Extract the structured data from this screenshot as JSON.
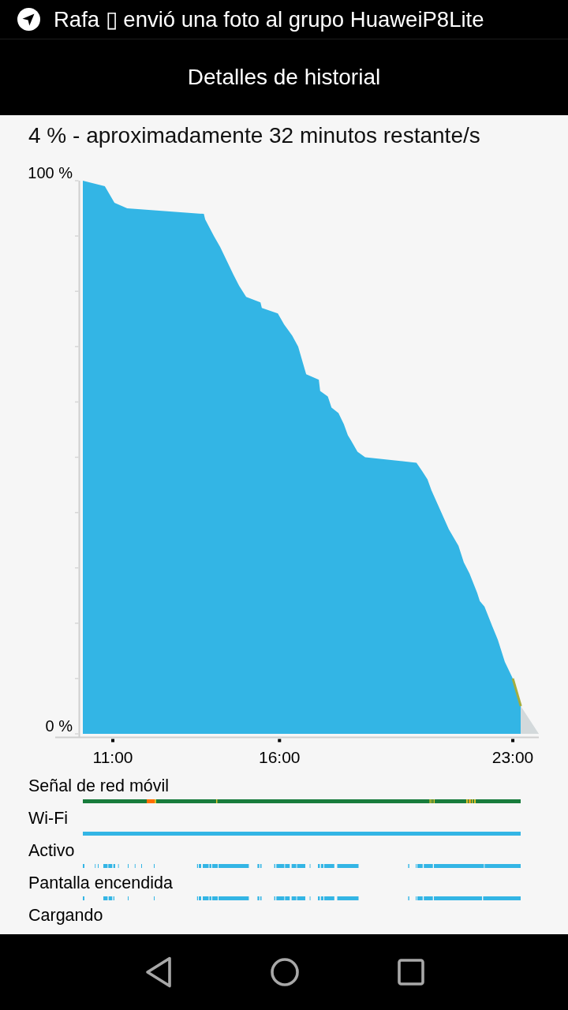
{
  "status_bar": {
    "notification": "Rafa ▯ envió una foto al grupo HuaweiP8Lite"
  },
  "app_bar": {
    "title": "Detalles de historial"
  },
  "summary": "4 % - aproximadamente 32 minutos restante/s",
  "chart": {
    "chart_data": {
      "type": "area",
      "x": [
        10.1,
        10.76,
        11.05,
        11.43,
        13.73,
        13.77,
        14.03,
        14.22,
        14.62,
        14.79,
        15.0,
        15.43,
        15.47,
        15.95,
        16.14,
        16.38,
        16.56,
        16.8,
        17.18,
        17.22,
        17.45,
        17.56,
        17.77,
        17.93,
        18.05,
        18.15,
        18.34,
        18.57,
        20.11,
        20.28,
        20.44,
        20.56,
        21.08,
        21.37,
        21.53,
        21.7,
        21.93,
        22.01,
        22.15,
        22.38,
        22.55,
        22.76,
        23.0,
        23.24,
        23.78
      ],
      "series": [
        {
          "color": "#33b5e5",
          "values": [
            100,
            99,
            96,
            95,
            94,
            93,
            90,
            88,
            83,
            81,
            79,
            78,
            77,
            76,
            74,
            72,
            70,
            65,
            64,
            62,
            61,
            59,
            58,
            56,
            54,
            53,
            51,
            50,
            49,
            47.5,
            46,
            44,
            37,
            34,
            31,
            29,
            25.5,
            24,
            23,
            19.5,
            17,
            13,
            10,
            5,
            null
          ]
        },
        {
          "color": "#d3d9db",
          "values": [
            null,
            null,
            null,
            null,
            null,
            null,
            null,
            null,
            null,
            null,
            null,
            null,
            null,
            null,
            null,
            null,
            null,
            null,
            null,
            null,
            null,
            null,
            null,
            null,
            null,
            null,
            null,
            null,
            null,
            null,
            null,
            null,
            null,
            null,
            null,
            null,
            null,
            null,
            null,
            null,
            null,
            null,
            null,
            5,
            0
          ]
        },
        {
          "type": "line",
          "color": "#a3ad3e",
          "values": [
            null,
            null,
            null,
            null,
            null,
            null,
            null,
            null,
            null,
            null,
            null,
            null,
            null,
            null,
            null,
            null,
            null,
            null,
            null,
            null,
            null,
            null,
            null,
            null,
            null,
            null,
            null,
            null,
            null,
            null,
            null,
            null,
            null,
            null,
            null,
            null,
            null,
            null,
            null,
            null,
            null,
            null,
            10,
            5,
            null
          ]
        }
      ],
      "xlim": [
        10.1,
        23.78
      ],
      "ylim": [
        0,
        100
      ],
      "xticks": [
        {
          "value": 11,
          "label": "11:00"
        },
        {
          "value": 16,
          "label": "16:00"
        },
        {
          "value": 23,
          "label": "23:00"
        }
      ],
      "yticks": [
        {
          "value": 0,
          "label": "0 %"
        },
        {
          "value": 100,
          "label": "100 %"
        }
      ]
    }
  },
  "tracks": [
    {
      "label": "Señal de red móvil",
      "kind": "signal"
    },
    {
      "label": "Wi-Fi",
      "kind": "wifi"
    },
    {
      "label": "Activo",
      "kind": "activity"
    },
    {
      "label": "Pantalla encendida",
      "kind": "screen"
    },
    {
      "label": "Cargando",
      "kind": "none"
    }
  ]
}
